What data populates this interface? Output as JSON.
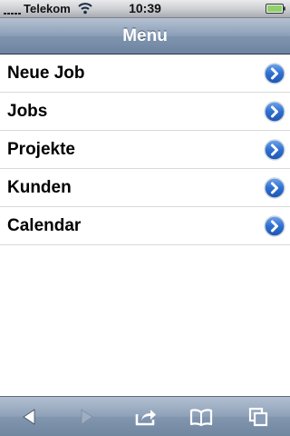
{
  "status_bar": {
    "carrier": "Telekom",
    "time": "10:39",
    "signal_icon": "signal-bars-icon",
    "wifi_icon": "wifi-icon",
    "battery_icon": "battery-icon"
  },
  "nav": {
    "title": "Menu"
  },
  "menu": {
    "items": [
      {
        "label": "Neue Job",
        "icon": "chevron-right-icon"
      },
      {
        "label": "Jobs",
        "icon": "chevron-right-icon"
      },
      {
        "label": "Projekte",
        "icon": "chevron-right-icon"
      },
      {
        "label": "Kunden",
        "icon": "chevron-right-icon"
      },
      {
        "label": "Calendar",
        "icon": "chevron-right-icon"
      }
    ]
  },
  "toolbar": {
    "buttons": [
      {
        "icon": "back-arrow-icon",
        "enabled": true
      },
      {
        "icon": "forward-arrow-icon",
        "enabled": false
      },
      {
        "icon": "share-icon",
        "enabled": true
      },
      {
        "icon": "bookmarks-icon",
        "enabled": true
      },
      {
        "icon": "tabs-icon",
        "enabled": true
      }
    ]
  },
  "colors": {
    "nav_bar": "#8c9fb8",
    "disclosure_blue": "#2f6fd0",
    "list_separator": "#d9d9d9"
  }
}
